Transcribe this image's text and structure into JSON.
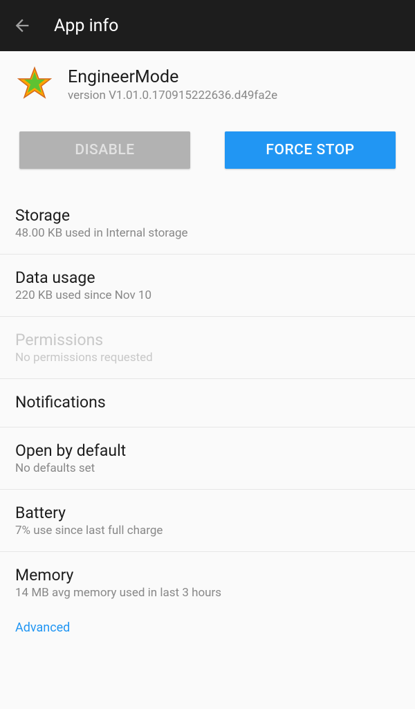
{
  "toolbar": {
    "title": "App info"
  },
  "app": {
    "name": "EngineerMode",
    "version": "version V1.01.0.170915222636.d49fa2e"
  },
  "buttons": {
    "disable": "DISABLE",
    "forceStop": "FORCE STOP"
  },
  "settings": {
    "storage": {
      "title": "Storage",
      "subtitle": "48.00 KB used in Internal storage"
    },
    "dataUsage": {
      "title": "Data usage",
      "subtitle": "220 KB used since Nov 10"
    },
    "permissions": {
      "title": "Permissions",
      "subtitle": "No permissions requested"
    },
    "notifications": {
      "title": "Notifications"
    },
    "openByDefault": {
      "title": "Open by default",
      "subtitle": "No defaults set"
    },
    "battery": {
      "title": "Battery",
      "subtitle": "7% use since last full charge"
    },
    "memory": {
      "title": "Memory",
      "subtitle": "14 MB avg memory used in last 3 hours"
    }
  },
  "advanced": "Advanced"
}
